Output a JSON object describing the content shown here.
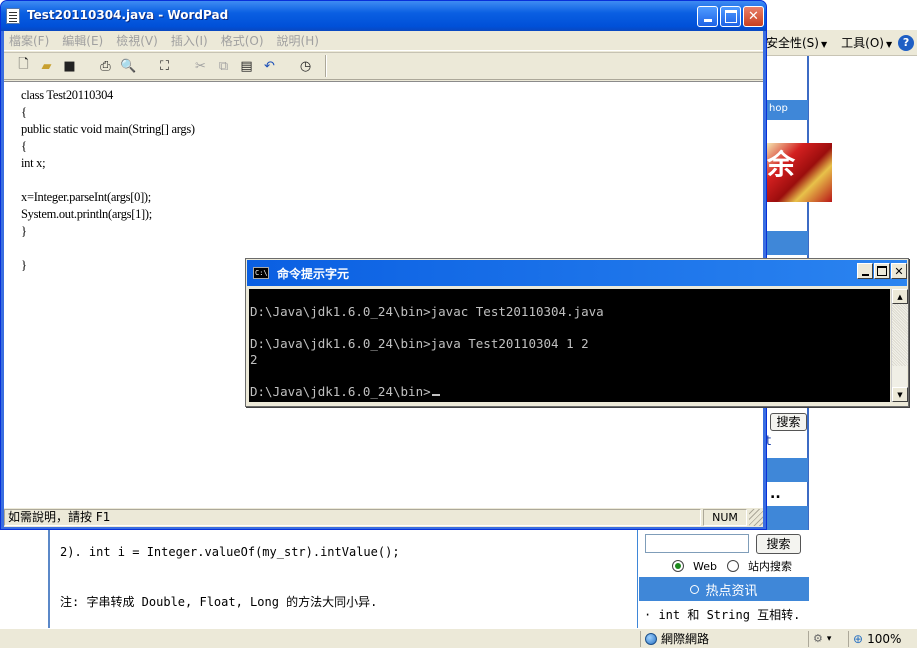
{
  "browser": {
    "toolbar": {
      "security": "安全性(S)",
      "tools": "工具(O)",
      "help_icon": "?"
    },
    "page": {
      "shop_text": "hop",
      "image_char": "余",
      "search_button": "搜索",
      "tick_char": "t",
      "dots": "..",
      "code_line": "2). int i = Integer.valueOf(my_str).intValue();",
      "note_line": "注: 字串转成 Double, Float, Long 的方法大同小异.",
      "sidebar": {
        "search_button": "搜索",
        "radio_web": "Web",
        "radio_site": "站内搜索",
        "hot_news": "热点资讯",
        "first_item": "· int 和 String 互相转."
      }
    },
    "status": {
      "zone": "網際網路",
      "zoom": "100%",
      "zoom_arrow": "▾"
    }
  },
  "wordpad": {
    "title": "Test20110304.java - WordPad",
    "menu": [
      "檔案(F)",
      "編輯(E)",
      "檢視(V)",
      "插入(I)",
      "格式(O)",
      "說明(H)"
    ],
    "toolbar_icons": [
      "new-icon",
      "open-icon",
      "save-icon",
      "print-icon",
      "print-preview-icon",
      "find-icon",
      "cut-icon",
      "copy-icon",
      "paste-icon",
      "undo-icon",
      "datetime-icon"
    ],
    "doc_lines": [
      "class Test20110304",
      "{",
      "public static void main(String[] args)",
      "{",
      "int x;",
      "",
      "x=Integer.parseInt(args[0]);",
      "System.out.println(args[1]);",
      "}",
      "",
      "}"
    ],
    "status_text": "如需說明，請按 F1",
    "status_num": "NUM"
  },
  "cmd": {
    "title": "命令提示字元",
    "icon_label": "C:\\",
    "lines": [
      "D:\\Java\\jdk1.6.0_24\\bin>javac Test20110304.java",
      "",
      "D:\\Java\\jdk1.6.0_24\\bin>java Test20110304 1 2",
      "2",
      "",
      "D:\\Java\\jdk1.6.0_24\\bin>"
    ]
  },
  "colors": {
    "xp_blue": "#0a5fe2",
    "ie_accent": "#3f87d8",
    "console_bg": "#000000",
    "console_fg": "#c0c0c0"
  }
}
